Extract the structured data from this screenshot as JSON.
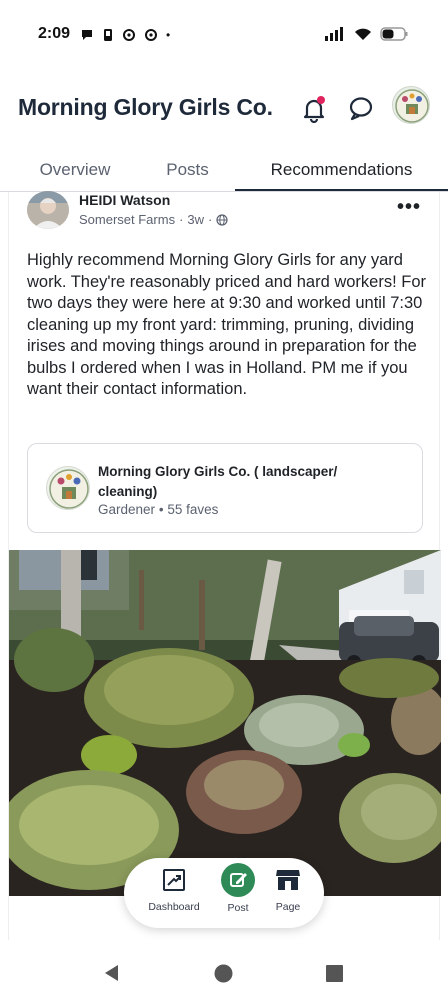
{
  "status": {
    "time": "2:09",
    "dot": "•"
  },
  "header": {
    "title": "Morning Glory Girls Co."
  },
  "tabs": [
    {
      "label": "Overview"
    },
    {
      "label": "Posts"
    },
    {
      "label": "Recommendations"
    }
  ],
  "post": {
    "author": "HEIDI Watson",
    "neighborhood": "Somerset Farms",
    "age": "3w",
    "separator": "·",
    "more": "•••",
    "body": "Highly recommend Morning Glory Girls for any yard work.  They're reasonably priced and hard workers!  For two days they were here at 9:30 and worked until 7:30 cleaning up my front yard: trimming, pruning, dividing irises and moving things around in preparation for the bulbs I ordered when I was in Holland.  PM me if you want their contact information."
  },
  "business": {
    "name": "Morning Glory Girls Co. ( landscaper/ cleaning)",
    "category": "Gardener",
    "faves": "55 faves",
    "dot": "•"
  },
  "nav": {
    "dashboard": "Dashboard",
    "post": "Post",
    "page": "Page"
  },
  "colors": {
    "accent_green": "#2e8b57",
    "notify_red": "#e0245e",
    "title_navy": "#1e2a3a"
  }
}
